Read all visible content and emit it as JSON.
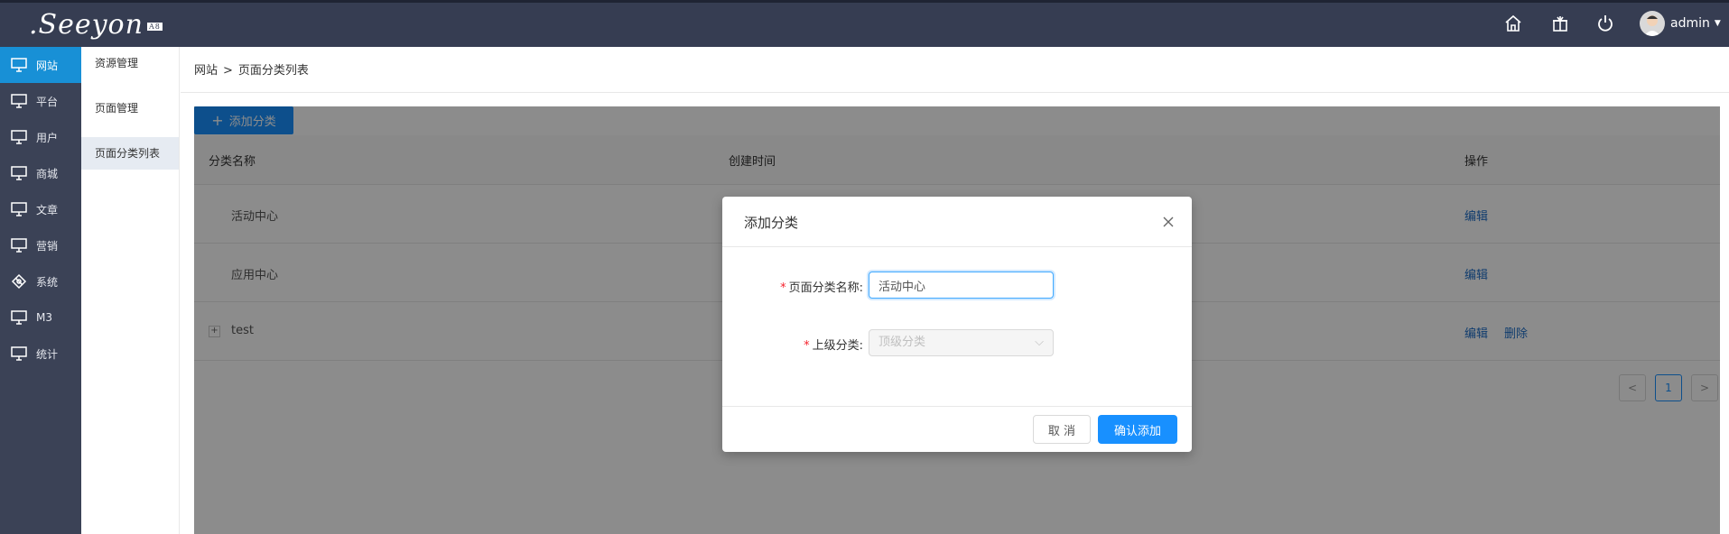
{
  "header": {
    "logo_text": ".Seeyon",
    "logo_badge": "A8",
    "username": "admin",
    "icons": [
      "home-icon",
      "gift-icon",
      "power-icon"
    ]
  },
  "leftnav": {
    "items": [
      {
        "label": "网站",
        "icon": "monitor-icon",
        "active": true
      },
      {
        "label": "平台",
        "icon": "monitor-icon"
      },
      {
        "label": "用户",
        "icon": "monitor-icon"
      },
      {
        "label": "商城",
        "icon": "monitor-icon"
      },
      {
        "label": "文章",
        "icon": "monitor-icon"
      },
      {
        "label": "营销",
        "icon": "monitor-icon"
      },
      {
        "label": "系统",
        "icon": "settings-icon"
      },
      {
        "label": "M3",
        "icon": "monitor-icon"
      },
      {
        "label": "统计",
        "icon": "monitor-icon"
      }
    ]
  },
  "subnav": {
    "items": [
      {
        "label": "资源管理"
      },
      {
        "label": "页面管理"
      },
      {
        "label": "页面分类列表",
        "active": true
      }
    ]
  },
  "breadcrumb": {
    "root": "网站",
    "separator": ">",
    "current": "页面分类列表"
  },
  "toolbar": {
    "add_label": "添加分类"
  },
  "table": {
    "columns": [
      "分类名称",
      "创建时间",
      "操作"
    ],
    "rows": [
      {
        "name": "活动中心",
        "actions": [
          "编辑"
        ]
      },
      {
        "name": "应用中心",
        "actions": [
          "编辑"
        ]
      },
      {
        "name": "test",
        "expandable": true,
        "actions": [
          "编辑",
          "删除"
        ]
      }
    ]
  },
  "pagination": {
    "prev": "<",
    "current": "1",
    "next": ">"
  },
  "modal": {
    "title": "添加分类",
    "name_label": "页面分类名称:",
    "name_value": "活动中心",
    "parent_label": "上级分类:",
    "parent_placeholder": "顶级分类",
    "required_mark": "*",
    "cancel_label": "取 消",
    "ok_label": "确认添加"
  },
  "colors": {
    "primary": "#1890ff",
    "topbar": "#363d52",
    "sidebar": "#3b4256",
    "link": "#1e6ec8"
  }
}
